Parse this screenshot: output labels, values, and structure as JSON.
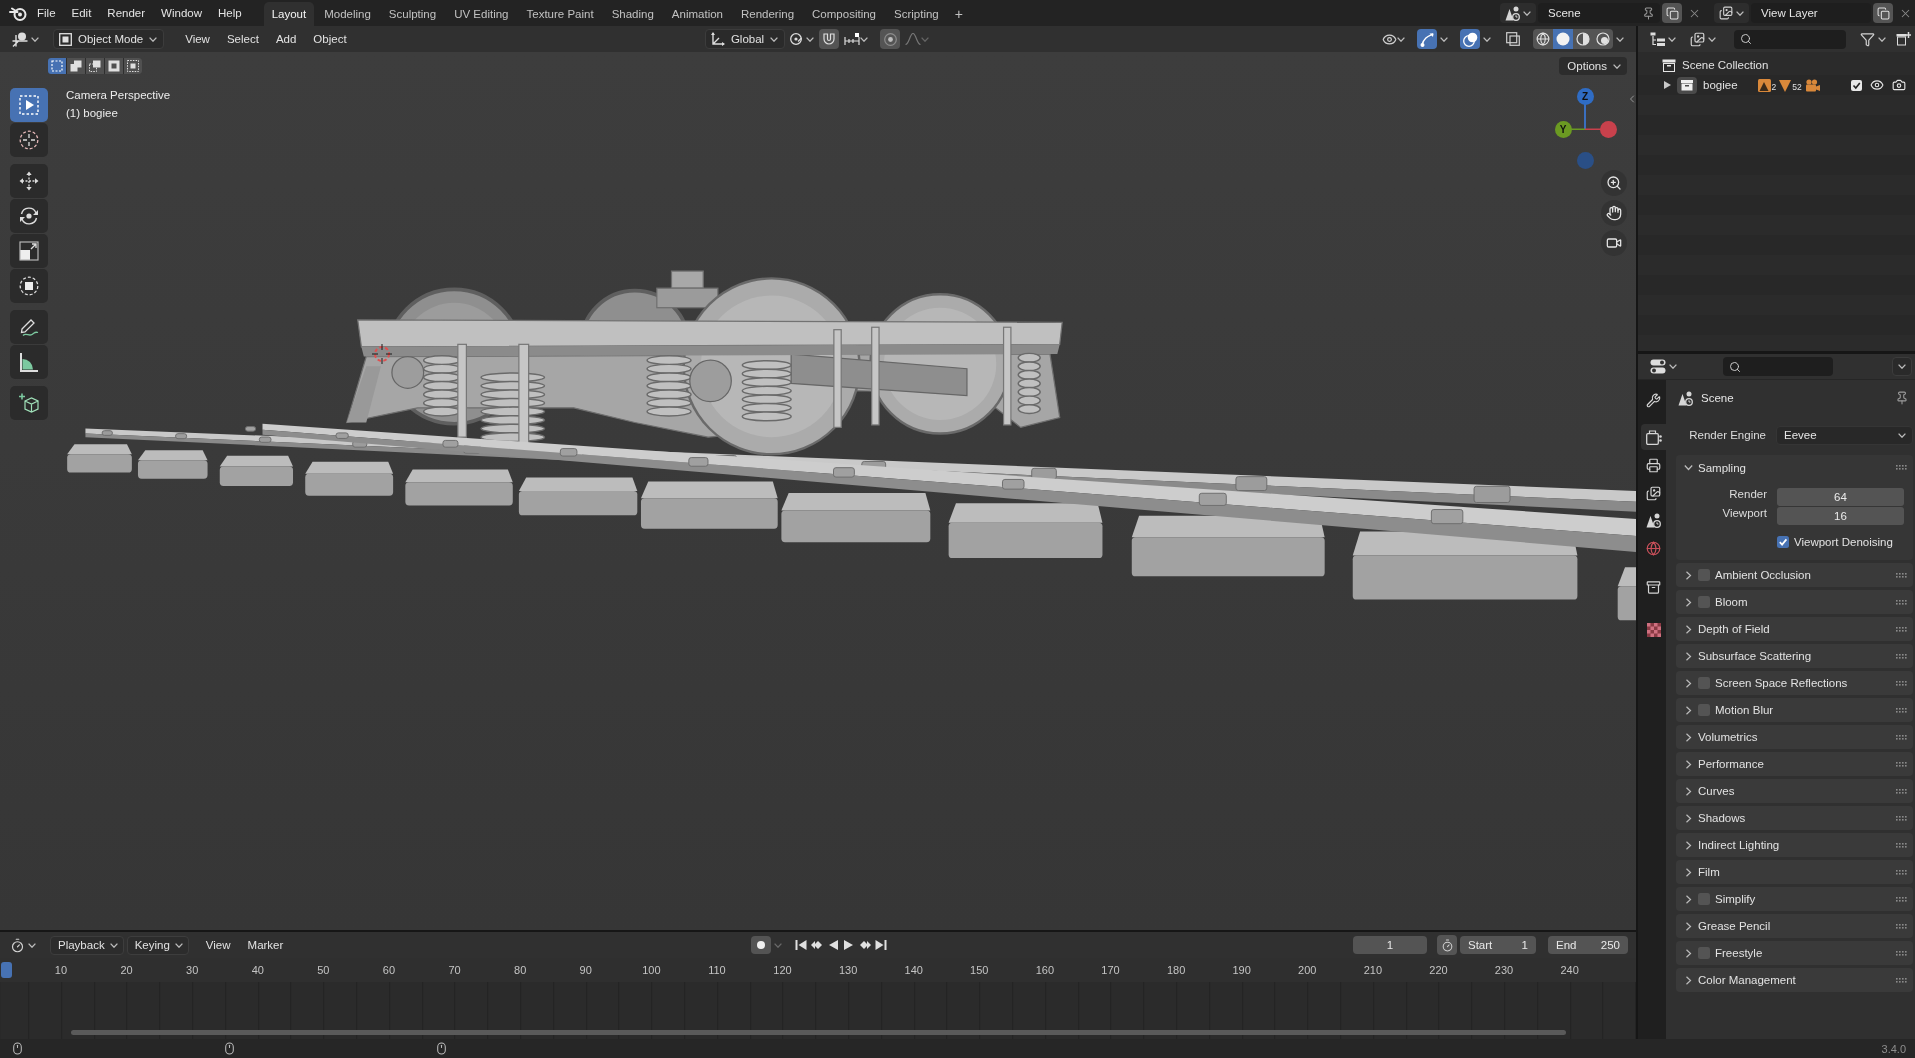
{
  "top_bar": {
    "menus": [
      "File",
      "Edit",
      "Render",
      "Window",
      "Help"
    ],
    "workspaces": [
      {
        "label": "Layout",
        "selected": true
      },
      {
        "label": "Modeling",
        "selected": false
      },
      {
        "label": "Sculpting",
        "selected": false
      },
      {
        "label": "UV Editing",
        "selected": false
      },
      {
        "label": "Texture Paint",
        "selected": false
      },
      {
        "label": "Shading",
        "selected": false
      },
      {
        "label": "Animation",
        "selected": false
      },
      {
        "label": "Rendering",
        "selected": false
      },
      {
        "label": "Compositing",
        "selected": false
      },
      {
        "label": "Scripting",
        "selected": false
      }
    ],
    "add_workspace": "+",
    "scene": "Scene",
    "view_layer": "View Layer"
  },
  "viewport": {
    "mode": "Object Mode",
    "menus": [
      "View",
      "Select",
      "Add",
      "Object"
    ],
    "orientation": "Global",
    "toggles": {
      "gizmos": true,
      "overlays": true,
      "xray": false
    },
    "shading_modes": [
      {
        "selected": false
      },
      {
        "selected": true
      },
      {
        "selected": false
      },
      {
        "selected": false
      }
    ],
    "select_modes": [
      {
        "selected": true
      },
      {
        "selected": false
      },
      {
        "selected": false
      },
      {
        "selected": false
      },
      {
        "selected": false
      }
    ],
    "options": "Options",
    "info": [
      "Camera Perspective",
      "(1) bogiee"
    ],
    "tools": [
      {
        "selected": true
      },
      {
        "selected": false
      },
      {
        "selected": false
      },
      {
        "selected": false
      },
      {
        "selected": false
      },
      {
        "selected": false
      },
      {
        "selected": false
      },
      {
        "selected": false
      },
      {
        "selected": false
      }
    ],
    "gizmo": [
      {
        "label": "Z",
        "color": "#2f6cc4"
      },
      {
        "label": "Y",
        "color": "#6b9a22"
      },
      {
        "color": "#c8414c"
      },
      {
        "color": "#2a4f86"
      }
    ]
  },
  "timeline": {
    "menus": [
      "Playback",
      "Keying",
      "View",
      "Marker"
    ],
    "current_frame": "1",
    "start_label": "Start",
    "start": "1",
    "end_label": "End",
    "end": "250",
    "ruler": [
      "10",
      "20",
      "30",
      "40",
      "50",
      "60",
      "70",
      "80",
      "90",
      "100",
      "110",
      "120",
      "130",
      "140",
      "150",
      "160",
      "170",
      "180",
      "190",
      "200",
      "210",
      "220",
      "230",
      "240"
    ]
  },
  "outliner": {
    "tree": [
      {
        "label": "Scene Collection",
        "children": [
          {
            "label": "bogiee",
            "expanded": false,
            "enabled": true,
            "counts": [
              "2",
              "52"
            ]
          }
        ]
      }
    ]
  },
  "properties": {
    "tabs": [
      {
        "selected": false
      },
      {
        "selected": true
      },
      {
        "selected": false
      },
      {
        "selected": false
      },
      {
        "selected": false
      },
      {
        "selected": false
      },
      {
        "selected": false
      },
      {
        "selected": false
      }
    ],
    "context": "Scene",
    "render_engine_label": "Render Engine",
    "render_engine": "Eevee",
    "panels": [
      {
        "label": "Sampling",
        "kind": "plain",
        "expanded": true,
        "fields": [
          {
            "label": "Render",
            "value": "64"
          },
          {
            "label": "Viewport",
            "value": "16"
          }
        ],
        "options": [
          {
            "label": "Viewport Denoising",
            "checked": true
          }
        ]
      },
      {
        "label": "Ambient Occlusion",
        "kind": "toggle",
        "checked": false,
        "expanded": false
      },
      {
        "label": "Bloom",
        "kind": "toggle",
        "checked": false,
        "expanded": false
      },
      {
        "label": "Depth of Field",
        "kind": "plain",
        "expanded": false
      },
      {
        "label": "Subsurface Scattering",
        "kind": "plain",
        "expanded": false
      },
      {
        "label": "Screen Space Reflections",
        "kind": "toggle",
        "checked": false,
        "expanded": false
      },
      {
        "label": "Motion Blur",
        "kind": "toggle",
        "checked": false,
        "expanded": false
      },
      {
        "label": "Volumetrics",
        "kind": "plain",
        "expanded": false
      },
      {
        "label": "Performance",
        "kind": "plain",
        "expanded": false
      },
      {
        "label": "Curves",
        "kind": "plain",
        "expanded": false
      },
      {
        "label": "Shadows",
        "kind": "plain",
        "expanded": false
      },
      {
        "label": "Indirect Lighting",
        "kind": "plain",
        "expanded": false
      },
      {
        "label": "Film",
        "kind": "plain",
        "expanded": false
      },
      {
        "label": "Simplify",
        "kind": "toggle",
        "checked": false,
        "expanded": false
      },
      {
        "label": "Grease Pencil",
        "kind": "plain",
        "expanded": false
      },
      {
        "label": "Freestyle",
        "kind": "toggle",
        "checked": false,
        "expanded": false
      },
      {
        "label": "Color Management",
        "kind": "plain",
        "expanded": false
      }
    ]
  },
  "status_bar": {
    "version": "3.4.0"
  }
}
